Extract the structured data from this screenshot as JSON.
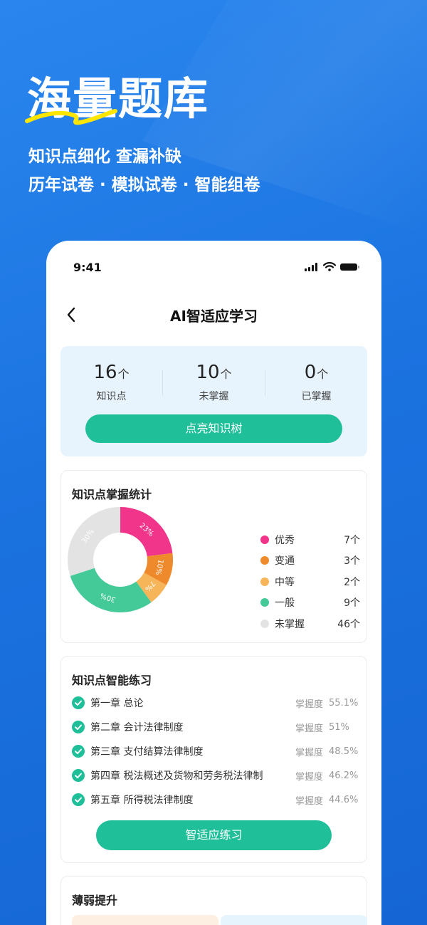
{
  "hero": {
    "title": "海量题库",
    "subtitle_1": "知识点细化  查漏补缺",
    "subtitle_2": "历年试卷 · 模拟试卷 · 智能组卷"
  },
  "status_bar": {
    "time": "9:41"
  },
  "nav": {
    "title": "AI智适应学习"
  },
  "stats": [
    {
      "value": "16",
      "unit": "个",
      "label": "知识点"
    },
    {
      "value": "10",
      "unit": "个",
      "label": "未掌握"
    },
    {
      "value": "0",
      "unit": "个",
      "label": "已掌握"
    }
  ],
  "light_tree_button": "点亮知识树",
  "mastery_stats": {
    "title": "知识点掌握统计",
    "legend": [
      {
        "label": "优秀",
        "value": "7个",
        "color": "#f0358a"
      },
      {
        "label": "变通",
        "value": "3个",
        "color": "#ef8a2c"
      },
      {
        "label": "中等",
        "value": "2个",
        "color": "#f7b55a"
      },
      {
        "label": "一般",
        "value": "9个",
        "color": "#44c999"
      },
      {
        "label": "未掌握",
        "value": "46个",
        "color": "#e3e3e3"
      }
    ]
  },
  "chart_data": {
    "type": "pie",
    "categories": [
      "优秀",
      "变通",
      "中等",
      "一般",
      "未掌握"
    ],
    "values": [
      23,
      10,
      7,
      30,
      30
    ],
    "labels": [
      "23%",
      "10%",
      "7%",
      "30%",
      "30%"
    ],
    "colors": [
      "#f0358a",
      "#ef8a2c",
      "#f7b55a",
      "#44c999",
      "#e3e3e3"
    ]
  },
  "smart_practice": {
    "title": "知识点智能练习",
    "mastery_label": "掌握度",
    "chapters": [
      {
        "title": "第一章 总论",
        "value": "55.1%"
      },
      {
        "title": "第二章 会计法律制度",
        "value": "51%"
      },
      {
        "title": "第三章 支付结算法律制度",
        "value": "48.5%"
      },
      {
        "title": "第四章 税法概述及货物和劳务税法律制",
        "value": "46.2%"
      },
      {
        "title": "第五章 所得税法律制度",
        "value": "44.6%"
      }
    ],
    "button": "智适应练习"
  },
  "weak": {
    "title": "薄弱提升"
  }
}
